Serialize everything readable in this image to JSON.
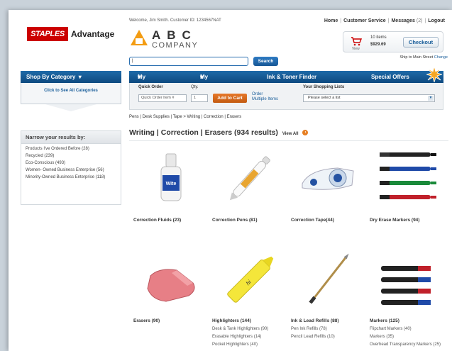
{
  "header": {
    "brand_staples": "STAPLES",
    "brand_advantage": "Advantage",
    "welcome": "Welcome, Jim Smith.  Customer ID: 1234567NAT",
    "company_abc": "ABC",
    "company_name": "COMPANY",
    "search_button": "Search",
    "search_value": "|",
    "links": {
      "home": "Home",
      "customer_service": "Customer Service",
      "messages": "Messages",
      "messages_count": "(2)",
      "logout": "Logout"
    },
    "cart": {
      "items": "10 items",
      "total": "$929.69",
      "view": "View",
      "checkout": "Checkout"
    },
    "ship_to": "Ship to Main Street",
    "ship_change": "Change"
  },
  "nav": {
    "shop_by_category": "Shop By Category",
    "my_orders": "My Orders",
    "my_account": "My Account",
    "ink_toner": "Ink & Toner Finder",
    "special_offers": "Special Offers",
    "see_all_categories": "Click to See All Categories"
  },
  "quick_order": {
    "label": "Quick Order",
    "qty_label": "Qty.",
    "item_placeholder": "Quick Order Item #",
    "qty_value": "1",
    "add_to_cart": "Add to Cart",
    "order_multiple_1": "Order",
    "order_multiple_2": "Multiple Items",
    "lists_label": "Your Shopping Lists",
    "list_select": "Please select a list"
  },
  "breadcrumb": "Pens | Desk Supplies | Tape  >  Writing | Correction | Erasers",
  "page_title": "Writing | Correction | Erasers (934 results)",
  "view_all": "View All",
  "narrow": {
    "title": "Narrow your results by:",
    "items": [
      "Products I've Ordered Before (28)",
      "Recycled (239)",
      "Eco-Conscious (493)",
      "Women- Owned Business Enterprise (56)",
      "Minority-Owned Business Enterprise (118)"
    ]
  },
  "products": [
    {
      "name": "Correction Fluids (23)",
      "subs": [],
      "icon": "correction-fluid"
    },
    {
      "name": "Correction Pens (81)",
      "subs": [],
      "icon": "correction-pen"
    },
    {
      "name": "Correction Tape(44)",
      "subs": [],
      "icon": "correction-tape"
    },
    {
      "name": "Dry Erase Markers (94)",
      "subs": [],
      "icon": "dry-erase-markers"
    },
    {
      "name": "Erasers (90)",
      "subs": [],
      "icon": "eraser"
    },
    {
      "name": "Highlighters (144)",
      "subs": [
        "Desk & Tank Highlighters (90)",
        "Erasable Highlighters (14)",
        "Pocket Highlighters (40)"
      ],
      "icon": "highlighter"
    },
    {
      "name": "Ink & Lead Refills (88)",
      "subs": [
        "Pen Ink Refills (78)",
        "Pencil Lead Refills (10)"
      ],
      "icon": "ink-refill"
    },
    {
      "name": "Markers (125)",
      "subs": [
        "Flipchart Markers (40)",
        "Markers (35)",
        "Overhead Transparency Markers (25)"
      ],
      "icon": "markers"
    }
  ]
}
